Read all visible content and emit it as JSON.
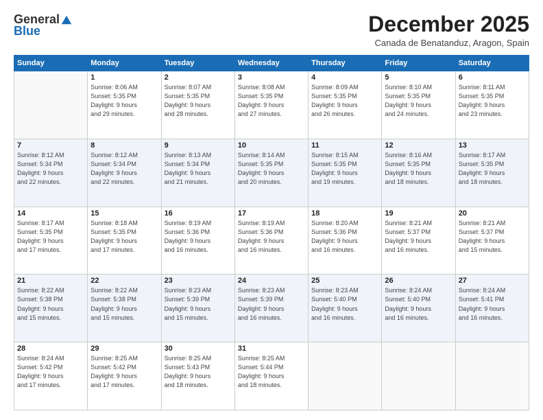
{
  "logo": {
    "general": "General",
    "blue": "Blue"
  },
  "title": "December 2025",
  "location": "Canada de Benatanduz, Aragon, Spain",
  "days_header": [
    "Sunday",
    "Monday",
    "Tuesday",
    "Wednesday",
    "Thursday",
    "Friday",
    "Saturday"
  ],
  "weeks": [
    [
      {
        "num": "",
        "info": ""
      },
      {
        "num": "1",
        "info": "Sunrise: 8:06 AM\nSunset: 5:35 PM\nDaylight: 9 hours\nand 29 minutes."
      },
      {
        "num": "2",
        "info": "Sunrise: 8:07 AM\nSunset: 5:35 PM\nDaylight: 9 hours\nand 28 minutes."
      },
      {
        "num": "3",
        "info": "Sunrise: 8:08 AM\nSunset: 5:35 PM\nDaylight: 9 hours\nand 27 minutes."
      },
      {
        "num": "4",
        "info": "Sunrise: 8:09 AM\nSunset: 5:35 PM\nDaylight: 9 hours\nand 26 minutes."
      },
      {
        "num": "5",
        "info": "Sunrise: 8:10 AM\nSunset: 5:35 PM\nDaylight: 9 hours\nand 24 minutes."
      },
      {
        "num": "6",
        "info": "Sunrise: 8:11 AM\nSunset: 5:35 PM\nDaylight: 9 hours\nand 23 minutes."
      }
    ],
    [
      {
        "num": "7",
        "info": "Sunrise: 8:12 AM\nSunset: 5:34 PM\nDaylight: 9 hours\nand 22 minutes."
      },
      {
        "num": "8",
        "info": "Sunrise: 8:12 AM\nSunset: 5:34 PM\nDaylight: 9 hours\nand 22 minutes."
      },
      {
        "num": "9",
        "info": "Sunrise: 8:13 AM\nSunset: 5:34 PM\nDaylight: 9 hours\nand 21 minutes."
      },
      {
        "num": "10",
        "info": "Sunrise: 8:14 AM\nSunset: 5:35 PM\nDaylight: 9 hours\nand 20 minutes."
      },
      {
        "num": "11",
        "info": "Sunrise: 8:15 AM\nSunset: 5:35 PM\nDaylight: 9 hours\nand 19 minutes."
      },
      {
        "num": "12",
        "info": "Sunrise: 8:16 AM\nSunset: 5:35 PM\nDaylight: 9 hours\nand 18 minutes."
      },
      {
        "num": "13",
        "info": "Sunrise: 8:17 AM\nSunset: 5:35 PM\nDaylight: 9 hours\nand 18 minutes."
      }
    ],
    [
      {
        "num": "14",
        "info": "Sunrise: 8:17 AM\nSunset: 5:35 PM\nDaylight: 9 hours\nand 17 minutes."
      },
      {
        "num": "15",
        "info": "Sunrise: 8:18 AM\nSunset: 5:35 PM\nDaylight: 9 hours\nand 17 minutes."
      },
      {
        "num": "16",
        "info": "Sunrise: 8:19 AM\nSunset: 5:36 PM\nDaylight: 9 hours\nand 16 minutes."
      },
      {
        "num": "17",
        "info": "Sunrise: 8:19 AM\nSunset: 5:36 PM\nDaylight: 9 hours\nand 16 minutes."
      },
      {
        "num": "18",
        "info": "Sunrise: 8:20 AM\nSunset: 5:36 PM\nDaylight: 9 hours\nand 16 minutes."
      },
      {
        "num": "19",
        "info": "Sunrise: 8:21 AM\nSunset: 5:37 PM\nDaylight: 9 hours\nand 16 minutes."
      },
      {
        "num": "20",
        "info": "Sunrise: 8:21 AM\nSunset: 5:37 PM\nDaylight: 9 hours\nand 15 minutes."
      }
    ],
    [
      {
        "num": "21",
        "info": "Sunrise: 8:22 AM\nSunset: 5:38 PM\nDaylight: 9 hours\nand 15 minutes."
      },
      {
        "num": "22",
        "info": "Sunrise: 8:22 AM\nSunset: 5:38 PM\nDaylight: 9 hours\nand 15 minutes."
      },
      {
        "num": "23",
        "info": "Sunrise: 8:23 AM\nSunset: 5:39 PM\nDaylight: 9 hours\nand 15 minutes."
      },
      {
        "num": "24",
        "info": "Sunrise: 8:23 AM\nSunset: 5:39 PM\nDaylight: 9 hours\nand 16 minutes."
      },
      {
        "num": "25",
        "info": "Sunrise: 8:23 AM\nSunset: 5:40 PM\nDaylight: 9 hours\nand 16 minutes."
      },
      {
        "num": "26",
        "info": "Sunrise: 8:24 AM\nSunset: 5:40 PM\nDaylight: 9 hours\nand 16 minutes."
      },
      {
        "num": "27",
        "info": "Sunrise: 8:24 AM\nSunset: 5:41 PM\nDaylight: 9 hours\nand 16 minutes."
      }
    ],
    [
      {
        "num": "28",
        "info": "Sunrise: 8:24 AM\nSunset: 5:42 PM\nDaylight: 9 hours\nand 17 minutes."
      },
      {
        "num": "29",
        "info": "Sunrise: 8:25 AM\nSunset: 5:42 PM\nDaylight: 9 hours\nand 17 minutes."
      },
      {
        "num": "30",
        "info": "Sunrise: 8:25 AM\nSunset: 5:43 PM\nDaylight: 9 hours\nand 18 minutes."
      },
      {
        "num": "31",
        "info": "Sunrise: 8:25 AM\nSunset: 5:44 PM\nDaylight: 9 hours\nand 18 minutes."
      },
      {
        "num": "",
        "info": ""
      },
      {
        "num": "",
        "info": ""
      },
      {
        "num": "",
        "info": ""
      }
    ]
  ]
}
